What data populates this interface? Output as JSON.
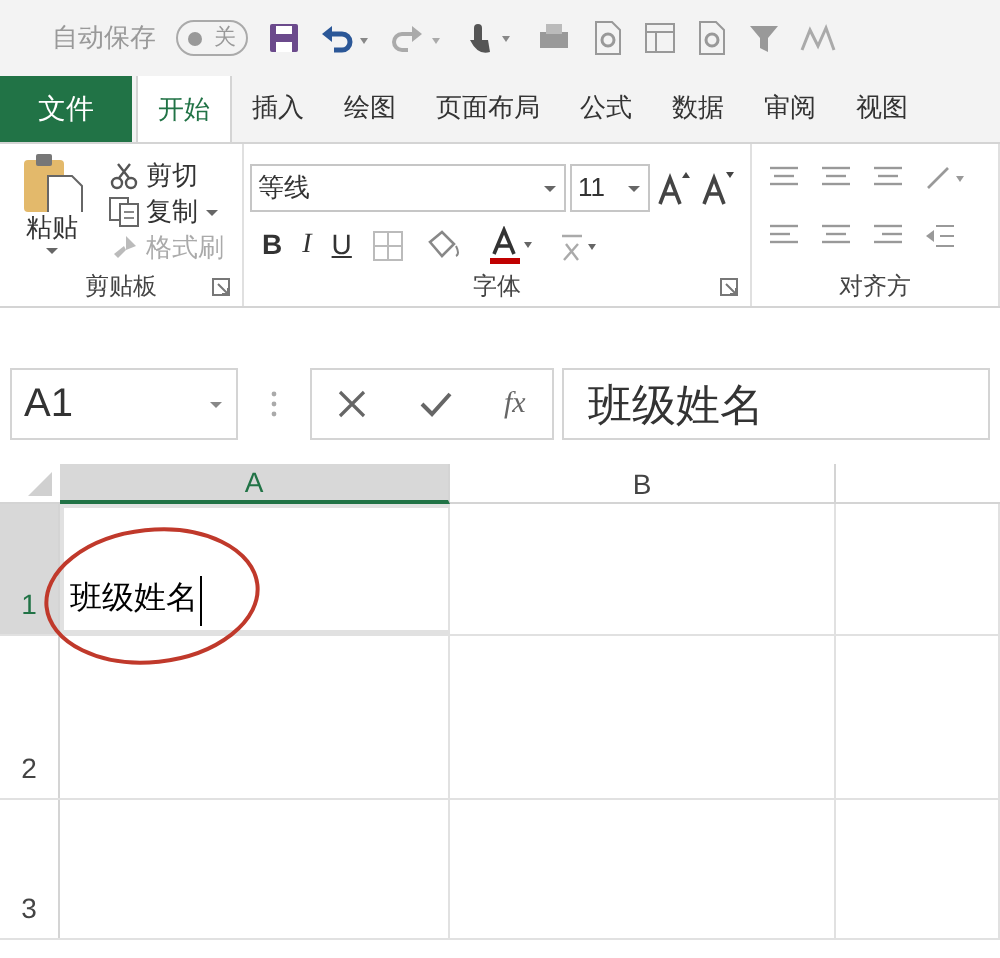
{
  "quick_access": {
    "autosave_label": "自动保存",
    "autosave": {
      "on": false,
      "label": "关"
    }
  },
  "tabs": [
    {
      "label": "文件",
      "kind": "file",
      "selected": false
    },
    {
      "label": "开始",
      "kind": "tab",
      "selected": true
    },
    {
      "label": "插入",
      "kind": "tab",
      "selected": false
    },
    {
      "label": "绘图",
      "kind": "tab",
      "selected": false
    },
    {
      "label": "页面布局",
      "kind": "tab",
      "selected": false
    },
    {
      "label": "公式",
      "kind": "tab",
      "selected": false
    },
    {
      "label": "数据",
      "kind": "tab",
      "selected": false
    },
    {
      "label": "审阅",
      "kind": "tab",
      "selected": false
    },
    {
      "label": "视图",
      "kind": "tab",
      "selected": false
    }
  ],
  "ribbon": {
    "clipboard": {
      "paste": "粘贴",
      "items": [
        {
          "label": "剪切",
          "kind": "cut",
          "disabled": false
        },
        {
          "label": "复制",
          "kind": "copy",
          "disabled": false
        },
        {
          "label": "格式刷",
          "kind": "painter",
          "disabled": true
        }
      ],
      "group_label": "剪贴板"
    },
    "font": {
      "font_name": "等线",
      "font_size": "11",
      "bold": "B",
      "italic": "I",
      "underline": "U",
      "group_label": "字体"
    },
    "alignment": {
      "group_label": "对齐方"
    }
  },
  "formula_bar": {
    "name_box": "A1",
    "fx": "fx",
    "formula": "班级姓名"
  },
  "sheet": {
    "columns": [
      {
        "label": "A",
        "selected": true
      },
      {
        "label": "B",
        "selected": false
      }
    ],
    "rows": [
      {
        "label": "1",
        "selected": true,
        "cell": {
          "value": "班级姓名",
          "active": true,
          "editing": true
        }
      },
      {
        "label": "2",
        "selected": false
      },
      {
        "label": "3",
        "selected": false
      }
    ]
  },
  "annotation": {
    "kind": "ellipse"
  }
}
